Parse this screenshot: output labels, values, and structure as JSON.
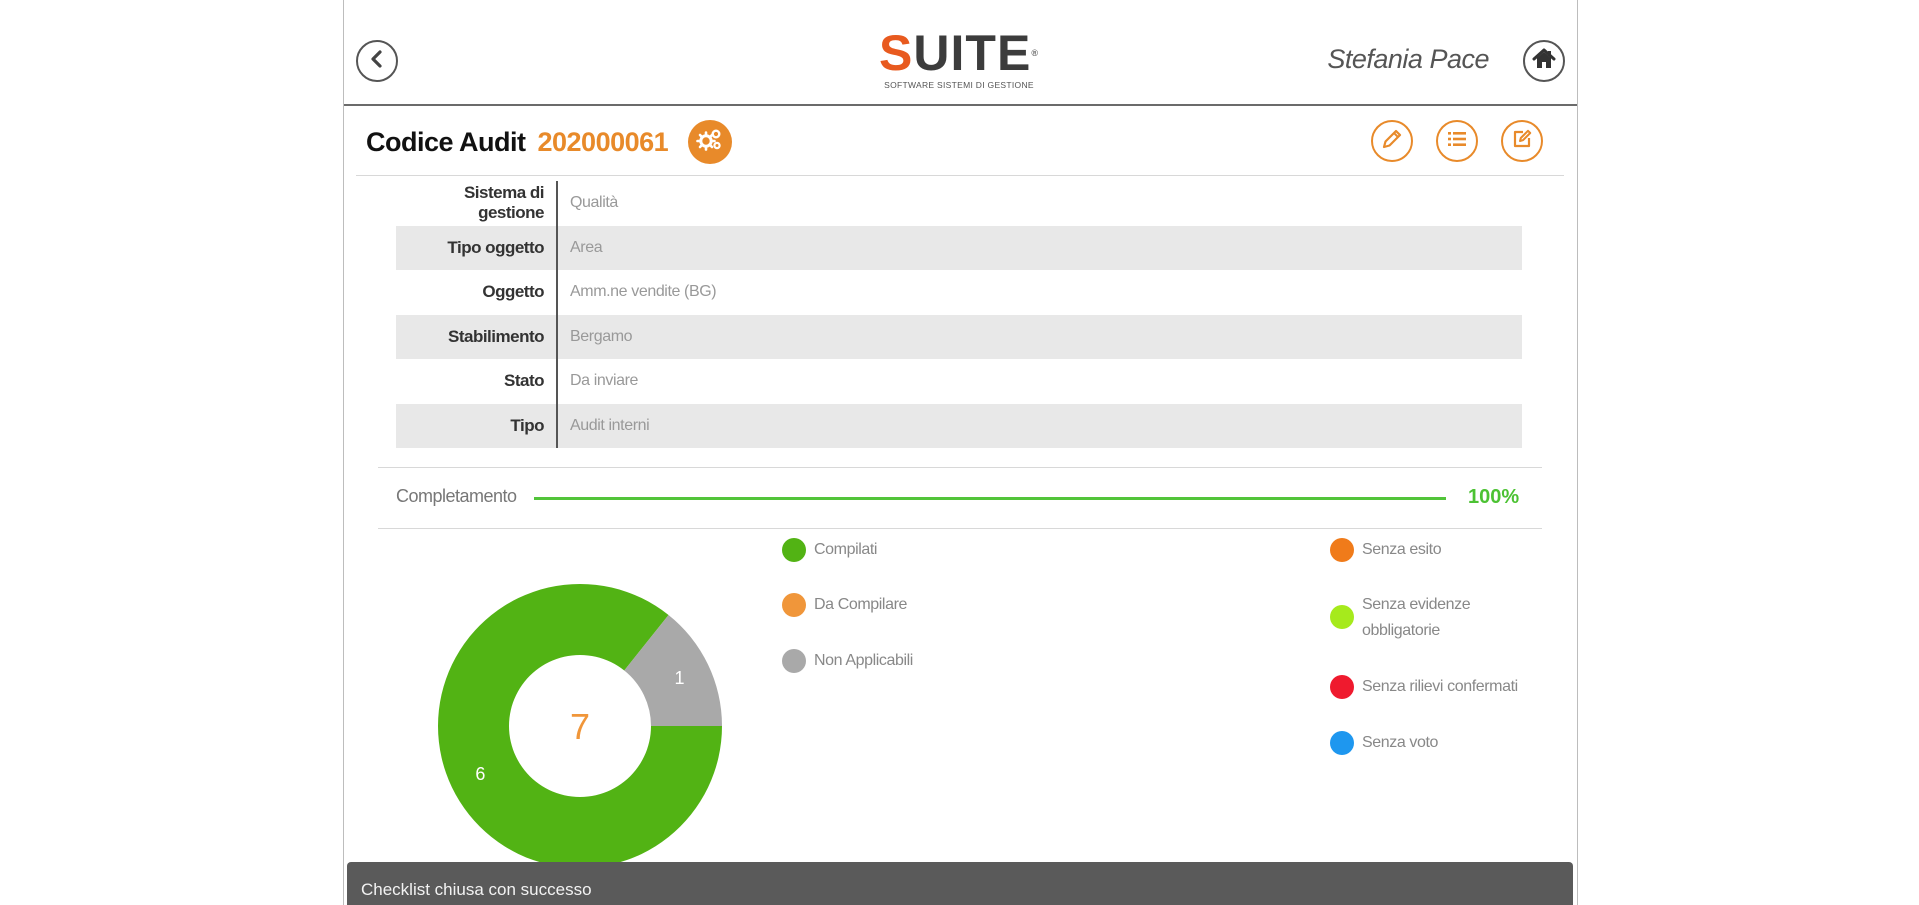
{
  "header": {
    "logo_main_first": "S",
    "logo_main_rest": "UITE",
    "logo_reg": "®",
    "logo_sub": "SOFTWARE SISTEMI DI GESTIONE",
    "user_name": "Stefania Pace",
    "back_icon": "chevron-left-icon",
    "home_icon": "home-icon"
  },
  "audit": {
    "title_label": "Codice Audit",
    "code": "202000061",
    "actions": [
      "pencil-icon",
      "list-icon",
      "edit-note-icon"
    ]
  },
  "info": [
    {
      "key": "Sistema di gestione",
      "value": "Qualità"
    },
    {
      "key": "Tipo oggetto",
      "value": "Area"
    },
    {
      "key": "Oggetto",
      "value": "Amm.ne vendite (BG)"
    },
    {
      "key": "Stabilimento",
      "value": "Bergamo"
    },
    {
      "key": "Stato",
      "value": "Da inviare"
    },
    {
      "key": "Tipo",
      "value": "Audit interni"
    }
  ],
  "completion": {
    "label": "Completamento",
    "percent_text": "100%",
    "percent_value": 100
  },
  "chart_data": {
    "type": "pie",
    "total": "7",
    "slices": [
      {
        "label": "Compilati",
        "value": 6,
        "color": "#52b314"
      },
      {
        "label": "Non Applicabili",
        "value": 1,
        "color": "#a9a9a9"
      }
    ]
  },
  "legend_left": [
    {
      "label": "Compilati",
      "color": "#52b314"
    },
    {
      "label": "Da Compilare",
      "color": "#f0963a"
    },
    {
      "label": "Non Applicabili",
      "color": "#a9a9a9"
    }
  ],
  "legend_right": [
    {
      "label": "Senza esito",
      "color": "#f07b1a"
    },
    {
      "label_line1": "Senza evidenze",
      "label_line2": "obbligatorie",
      "color": "#a6ea1c"
    },
    {
      "label": "Senza rilievi confermati",
      "color": "#ef1a2e"
    },
    {
      "label": "Senza voto",
      "color": "#1e97ef"
    }
  ],
  "toast": {
    "message": "Checklist chiusa con successo"
  },
  "colors": {
    "accent": "#e88a2a",
    "progress": "#52c43a"
  }
}
